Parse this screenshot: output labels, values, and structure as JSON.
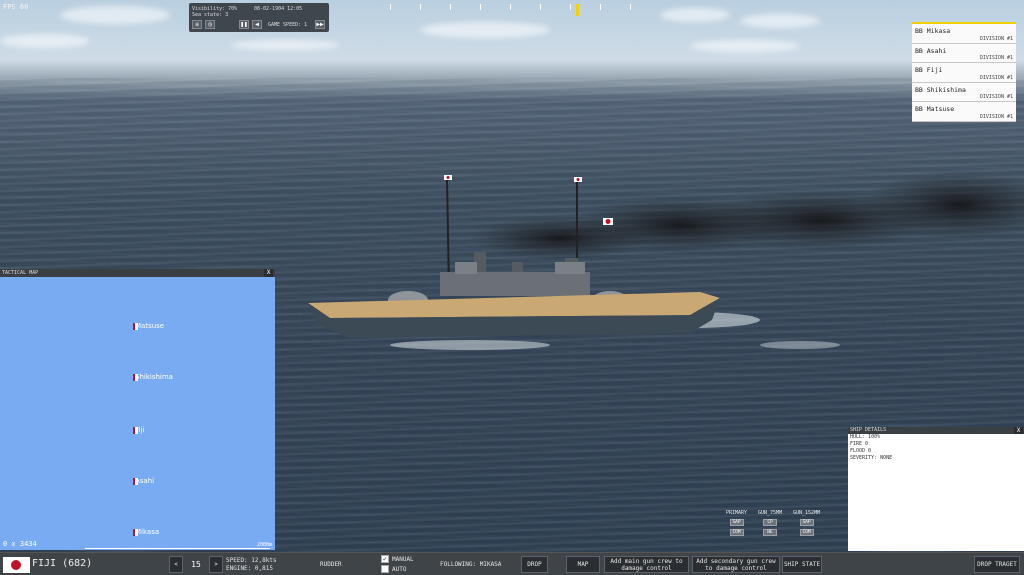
{
  "hud": {
    "fps": "FPS 60"
  },
  "info_panel": {
    "visibility": "Visibility: 70%",
    "sea_state": "Sea state: 3",
    "datetime": "08-02-1904 12:05",
    "game_speed": "GAME SPEED: 1"
  },
  "ship_list": {
    "items": [
      {
        "name": "BB Mikasa",
        "division": "DIVISION #1"
      },
      {
        "name": "BB Asahi",
        "division": "DIVISION #1"
      },
      {
        "name": "BB Fiji",
        "division": "DIVISION #1"
      },
      {
        "name": "BB Shikishima",
        "division": "DIVISION #1"
      },
      {
        "name": "BB Matsuse",
        "division": "DIVISION #1"
      }
    ]
  },
  "tactical_map": {
    "title": "TACTICAL MAP",
    "close": "X",
    "ships": [
      "Matsuse",
      "Shikishima",
      "Fiji",
      "Asahi",
      "Mikasa"
    ],
    "coords": "0 x 3434",
    "scale": "2000m"
  },
  "ship_details": {
    "title": "SHIP DETAILS",
    "close": "X",
    "hull": "HULL: 100%",
    "fire": "FIRE 0",
    "flood": "FLOOD 0",
    "severity": "SEVERITY: NONE"
  },
  "guns": {
    "primary": {
      "label": "PRIMARY",
      "ammo": "SAP",
      "mode": "COM"
    },
    "gun_75": {
      "label": "GUN_75MM",
      "ammo": "CP",
      "mode": "HE"
    },
    "gun_152": {
      "label": "GUN_152MM",
      "ammo": "SAP",
      "mode": "COM"
    }
  },
  "bottom_bar": {
    "ship_title": "FIJI (682)",
    "prev": "<",
    "speed_setting": "15",
    "next": ">",
    "speed": "SPEED: 12,8kts",
    "engine": "ENGINE: 0,815",
    "rudder": "RUDDER",
    "manual": "MANUAL",
    "auto": "AUTO",
    "following": "FOLLOWING: MIKASA",
    "drop": "DROP",
    "map": "MAP",
    "main_crew": "Add main gun crew to damage control",
    "secondary_crew": "Add secondary gun crew to damage control",
    "ship_state": "SHIP STATE",
    "drop_target": "DROP TRAGET"
  },
  "colors": {
    "map_water": "#79abf2",
    "accent": "#f2d000",
    "bar_bg": "#3f4449",
    "flag_red": "#c0102a"
  }
}
